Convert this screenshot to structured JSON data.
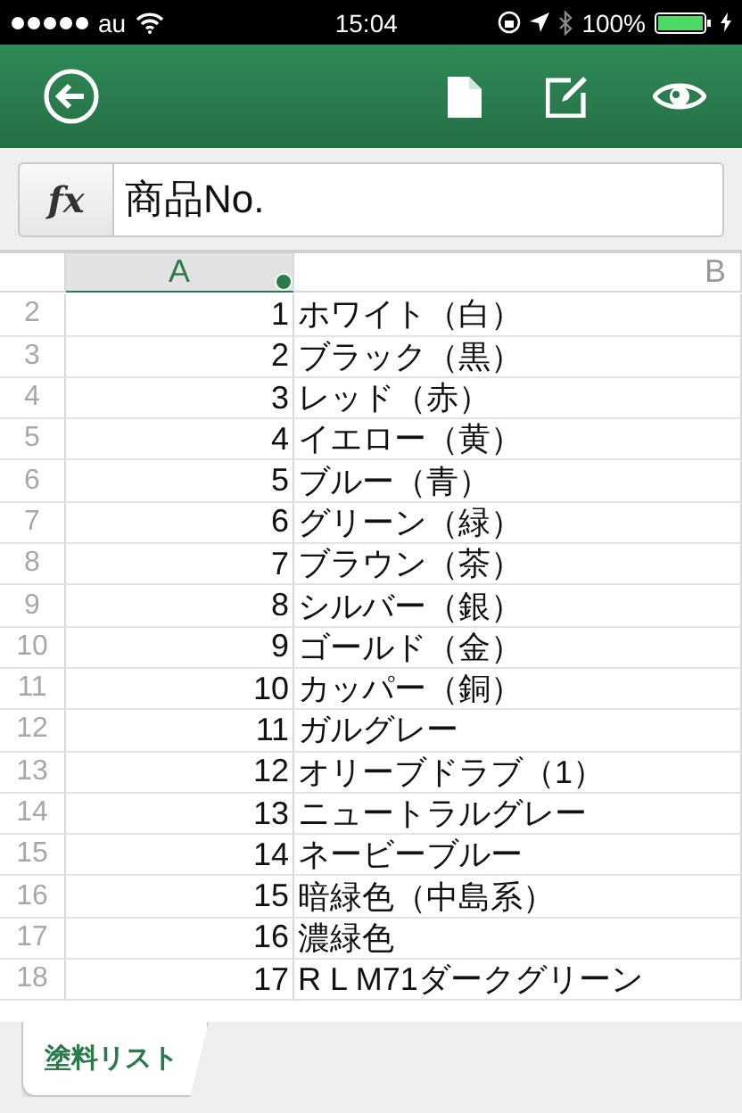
{
  "status_bar": {
    "carrier": "au",
    "time": "15:04",
    "battery": "100%"
  },
  "formula_bar": {
    "function_label": "fx",
    "value": "商品No."
  },
  "columns": [
    {
      "label": "A",
      "selected": true
    },
    {
      "label": "B",
      "selected": false
    }
  ],
  "rows": [
    {
      "number": "2",
      "cells": [
        "1",
        "ホワイト（白）"
      ]
    },
    {
      "number": "3",
      "cells": [
        "2",
        "ブラック（黒）"
      ]
    },
    {
      "number": "4",
      "cells": [
        "3",
        "レッド（赤）"
      ]
    },
    {
      "number": "5",
      "cells": [
        "4",
        "イエロー（黄）"
      ]
    },
    {
      "number": "6",
      "cells": [
        "5",
        "ブルー（青）"
      ]
    },
    {
      "number": "7",
      "cells": [
        "6",
        "グリーン（緑）"
      ]
    },
    {
      "number": "8",
      "cells": [
        "7",
        "ブラウン（茶）"
      ]
    },
    {
      "number": "9",
      "cells": [
        "8",
        "シルバー（銀）"
      ]
    },
    {
      "number": "10",
      "cells": [
        "9",
        "ゴールド（金）"
      ]
    },
    {
      "number": "11",
      "cells": [
        "10",
        "カッパー（銅）"
      ]
    },
    {
      "number": "12",
      "cells": [
        "11",
        "ガルグレー"
      ]
    },
    {
      "number": "13",
      "cells": [
        "12",
        "オリーブドラブ（1）"
      ]
    },
    {
      "number": "14",
      "cells": [
        "13",
        "ニュートラルグレー"
      ]
    },
    {
      "number": "15",
      "cells": [
        "14",
        "ネービーブルー"
      ]
    },
    {
      "number": "16",
      "cells": [
        "15",
        "暗緑色（中島系）"
      ]
    },
    {
      "number": "17",
      "cells": [
        "16",
        "濃緑色"
      ]
    },
    {
      "number": "18",
      "cells": [
        "17",
        "R L M71ダークグリーン"
      ]
    }
  ],
  "sheet_tabs": [
    {
      "label": "塗料リスト",
      "selected": true
    }
  ]
}
